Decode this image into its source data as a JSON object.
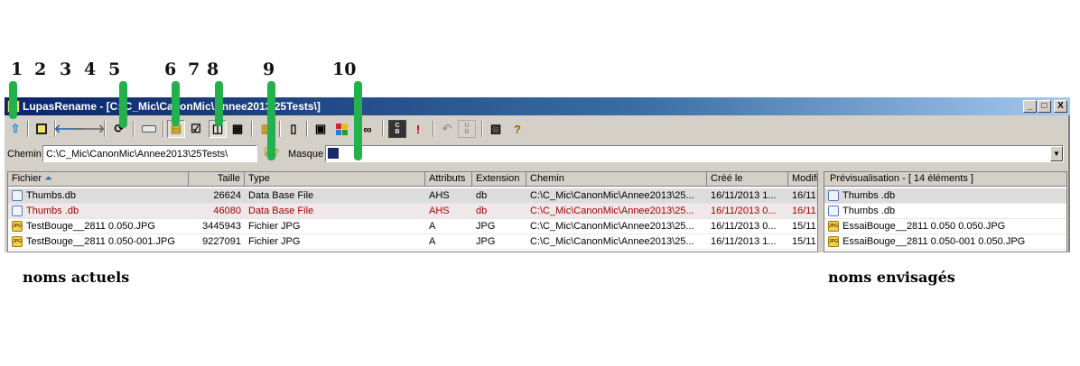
{
  "annotations": {
    "numbers": [
      "1",
      "2",
      "3",
      "4",
      "5",
      "6",
      "7",
      "8",
      "9",
      "10"
    ],
    "captions": {
      "current_names": "noms actuels",
      "planned_names": "noms envisagés"
    },
    "arrow_color": "#22b14c"
  },
  "window": {
    "title": "LupasRename - [C:\\C_Mic\\CanonMic\\Annee2013\\25Tests\\]",
    "controls": {
      "minimize": "_",
      "maximize": "□",
      "close": "X"
    }
  },
  "toolbar": {
    "icons": [
      "up-arrow-icon",
      "properties-icon",
      "back-icon",
      "forward-icon",
      "refresh-icon",
      "drive-icon",
      "select-files-icon",
      "checklist-icon",
      "dual-pane-icon",
      "grid-view-icon",
      "rename-options-icon",
      "document-icon",
      "picture-icon",
      "color-icon",
      "glasses-icon",
      "cmd-bat-icon",
      "exclamation-icon",
      "undo-icon",
      "undo-bat-icon",
      "help-book-icon",
      "question-icon"
    ]
  },
  "pathbar": {
    "chemin_label": "Chemin",
    "chemin_value": "C:\\C_Mic\\CanonMic\\Annee2013\\25Tests\\",
    "masque_label": "Masque",
    "masque_value": ""
  },
  "file_list": {
    "columns": [
      "Fichier",
      "Taille",
      "Type",
      "Attributs",
      "Extension",
      "Chemin",
      "Créé le",
      "Modifi"
    ],
    "rows": [
      {
        "name": "Thumbs.db",
        "size": "26624",
        "type": "Data Base File",
        "attrs": "AHS",
        "ext": "db",
        "path": "C:\\C_Mic\\CanonMic\\Annee2013\\25...",
        "created": "16/11/2013 1...",
        "modified": "16/11"
      },
      {
        "name": "Thumbs .db",
        "size": "46080",
        "type": "Data Base File",
        "attrs": "AHS",
        "ext": "db",
        "path": "C:\\C_Mic\\CanonMic\\Annee2013\\25...",
        "created": "16/11/2013 0...",
        "modified": "16/11"
      },
      {
        "name": "TestBouge__2811 0.050.JPG",
        "size": "3445943",
        "type": "Fichier JPG",
        "attrs": "A",
        "ext": "JPG",
        "path": "C:\\C_Mic\\CanonMic\\Annee2013\\25...",
        "created": "16/11/2013 0...",
        "modified": "15/11"
      },
      {
        "name": "TestBouge__2811 0.050-001.JPG",
        "size": "9227091",
        "type": "Fichier JPG",
        "attrs": "A",
        "ext": "JPG",
        "path": "C:\\C_Mic\\CanonMic\\Annee2013\\25...",
        "created": "16/11/2013 1...",
        "modified": "15/11"
      }
    ]
  },
  "preview": {
    "header": "Prévisualisation - [ 14 éléments ]",
    "items": [
      "Thumbs .db",
      "Thumbs .db",
      "EssaiBouge__2811 0.050 0.050.JPG",
      "EssaiBouge__2811 0.050-001 0.050.JPG"
    ]
  }
}
